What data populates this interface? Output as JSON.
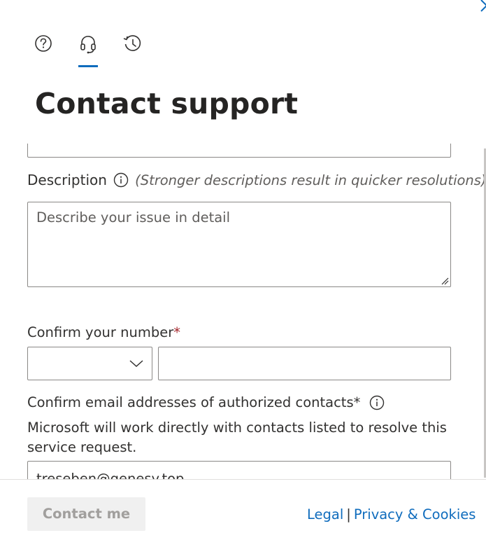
{
  "tabs": [
    {
      "icon": "help-icon",
      "label": ""
    },
    {
      "icon": "headset-icon",
      "label": "",
      "active": true
    },
    {
      "icon": "history-icon",
      "label": ""
    }
  ],
  "page_title": "Contact support",
  "description": {
    "label": "Description",
    "hint": "(Stronger descriptions result in quicker resolutions)",
    "placeholder": "Describe your issue in detail"
  },
  "confirm_number": {
    "label": "Confirm your number",
    "required_mark": "*"
  },
  "confirm_email": {
    "label": "Confirm email addresses of authorized contacts",
    "required_mark": "*",
    "help_text": "Microsoft will work directly with contacts listed to resolve this service request.",
    "value": "treseben@genesy.top"
  },
  "footer": {
    "contact_button": "Contact me",
    "legal_link": "Legal",
    "separator": "|",
    "privacy_link": "Privacy & Cookies"
  },
  "colors": {
    "accent": "#0f6cbd",
    "required": "#a4262c",
    "disabled_bg": "#f0f0f0",
    "disabled_text": "#a19f9d"
  }
}
